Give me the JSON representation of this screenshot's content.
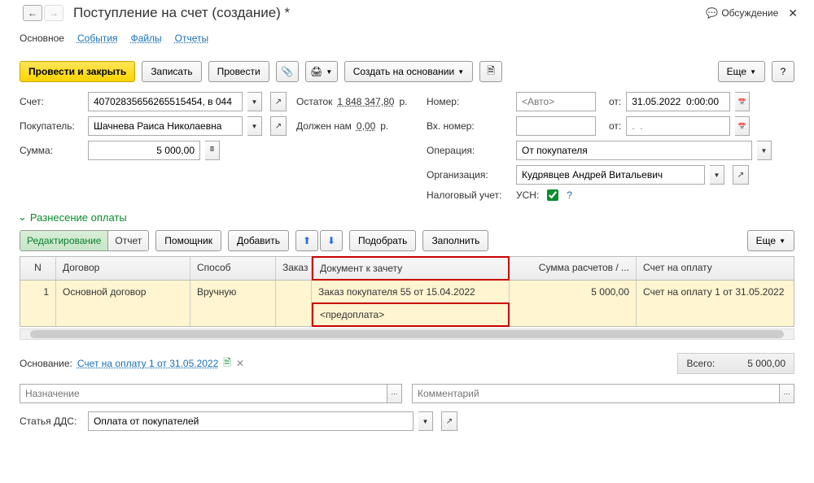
{
  "header": {
    "title": "Поступление на счет (создание) *",
    "discuss": "Обсуждение"
  },
  "tabs": [
    "Основное",
    "События",
    "Файлы",
    "Отчеты"
  ],
  "toolbar": {
    "post_close": "Провести и закрыть",
    "write": "Записать",
    "post": "Провести",
    "create_based": "Создать на основании",
    "more": "Еще"
  },
  "left": {
    "account_lbl": "Счет:",
    "account_val": "40702835656265515454, в 044",
    "balance_lbl": "Остаток",
    "balance_val": "1 848 347,80",
    "balance_cur": "р.",
    "buyer_lbl": "Покупатель:",
    "buyer_val": "Шачнева Раиса Николаевна",
    "owes_lbl": "Должен нам",
    "owes_val": "0,00",
    "owes_cur": "р.",
    "sum_lbl": "Сумма:",
    "sum_val": "5 000,00"
  },
  "right": {
    "num_lbl": "Номер:",
    "num_ph": "<Авто>",
    "from_lbl": "от:",
    "date_val": "31.05.2022  0:00:00",
    "in_num_lbl": "Вх. номер:",
    "in_date_ph": ".  .",
    "op_lbl": "Операция:",
    "op_val": "От покупателя",
    "org_lbl": "Организация:",
    "org_val": "Кудрявцев Андрей Витальевич",
    "tax_lbl": "Налоговый учет:",
    "tax_val": "УСН:"
  },
  "section": "Разнесение оплаты",
  "tbl_toolbar": {
    "edit": "Редактирование",
    "report": "Отчет",
    "helper": "Помощник",
    "add": "Добавить",
    "pick": "Подобрать",
    "fill": "Заполнить",
    "more": "Еще"
  },
  "cols": {
    "n": "N",
    "dog": "Договор",
    "sp": "Способ",
    "zak": "Заказ",
    "doc": "Документ к зачету",
    "sum": "Сумма расчетов / ...",
    "sch": "Счет на оплату"
  },
  "row": {
    "n": "1",
    "dog": "Основной договор",
    "sp": "Вручную",
    "doc": "Заказ покупателя 55 от 15.04.2022",
    "doc2": "<предоплата>",
    "sum": "5 000,00",
    "sch": "Счет на оплату 1 от 31.05.2022"
  },
  "footer": {
    "base_lbl": "Основание:",
    "base_link": "Счет на оплату 1 от 31.05.2022",
    "total_lbl": "Всего:",
    "total_val": "5 000,00",
    "naz_ph": "Назначение",
    "com_ph": "Комментарий",
    "dds_lbl": "Статья ДДС:",
    "dds_val": "Оплата от покупателей"
  }
}
